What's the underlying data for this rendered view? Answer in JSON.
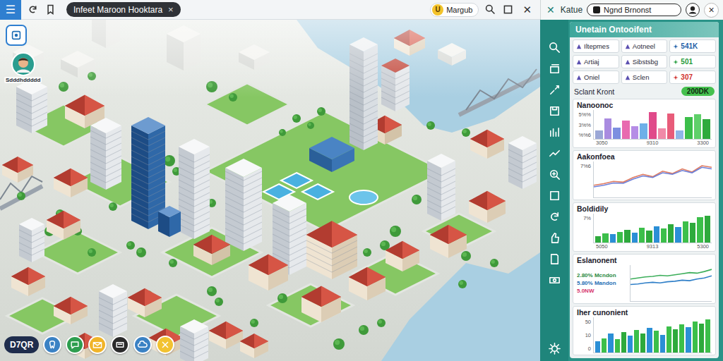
{
  "window": {
    "title": "Infeet Maroon Hooktara",
    "tab_close": "×",
    "menu": "☰",
    "close": "✕"
  },
  "currency": {
    "symbol": "U",
    "label": "Margub"
  },
  "player": {
    "name": "Sdddhddddd"
  },
  "toolbar": {
    "label": "D7QR"
  },
  "panel": {
    "close_left": "✕",
    "title": "Katue",
    "search": "Ngnd Brnonst",
    "close": "×",
    "heading": "Unetain Ontooifent",
    "stats": [
      {
        "label": "Iltepmes",
        "kind": "label"
      },
      {
        "label": "Aotneel",
        "kind": "label"
      },
      {
        "label": "541K",
        "kind": "value",
        "color": "#1f5fa8"
      },
      {
        "label": "Artiaj",
        "kind": "label"
      },
      {
        "label": "Sibstsbg",
        "kind": "label"
      },
      {
        "label": "501",
        "kind": "value",
        "color": "#1f9a3a"
      },
      {
        "label": "Oniel",
        "kind": "label"
      },
      {
        "label": "Sclen",
        "kind": "label"
      },
      {
        "label": "307",
        "kind": "value",
        "color": "#d0312d"
      }
    ],
    "summary": {
      "label": "Sclant Kront",
      "value": "200DK"
    },
    "charts": [
      {
        "title": "Nanoonoc",
        "kind": "bar",
        "ticks": [
          "5%%",
          "3%%",
          "%%6"
        ],
        "xlabels": [
          "3050",
          "9310",
          "3300"
        ],
        "values": [
          28,
          70,
          38,
          62,
          44,
          52,
          90,
          36,
          86,
          30,
          74,
          82,
          66
        ],
        "colors": [
          "#9aa7d6",
          "#a98be0",
          "#7d8fe0",
          "#e86ab0",
          "#b58ce6",
          "#6fb0e8",
          "#e04a8a",
          "#f08aa8",
          "#e85c7a",
          "#8fb6e8",
          "#3cbf4a",
          "#5fd06a",
          "#2eaa3c"
        ]
      },
      {
        "title": "Aakonfoea",
        "kind": "line",
        "ticks": [
          "7%6"
        ],
        "series": [
          {
            "values": [
              30,
              34,
              40,
              38,
              50,
              58,
              52,
              66,
              60,
              72,
              64,
              80,
              76
            ],
            "color": "#e07a5f"
          },
          {
            "values": [
              26,
              30,
              36,
              35,
              46,
              54,
              50,
              62,
              58,
              68,
              62,
              76,
              72
            ],
            "color": "#6c7fd8"
          }
        ]
      },
      {
        "title": "Boldidily",
        "kind": "bar",
        "ticks": [
          "7%"
        ],
        "xlabels": [
          "5050",
          "9313",
          "5300"
        ],
        "values": [
          20,
          30,
          26,
          34,
          40,
          32,
          46,
          38,
          50,
          44,
          58,
          48,
          66,
          62,
          80,
          84
        ],
        "colors": [
          "#2eaa3c",
          "#3cbf4a",
          "#2b8fd6",
          "#3cbf4a",
          "#2eaa3c",
          "#2b8fd6",
          "#3cbf4a",
          "#2eaa3c",
          "#2b8fd6",
          "#3cbf4a",
          "#2eaa3c",
          "#2b8fd6",
          "#3cbf4a",
          "#2eaa3c",
          "#3cbf4a",
          "#2eaa3c"
        ]
      },
      {
        "title": "Eslanonent",
        "kind": "line",
        "legend": [
          {
            "text": "2.80% Mcndon",
            "color": "#2b8a3e"
          },
          {
            "text": "5.80% Mandon",
            "color": "#1f6fb5"
          },
          {
            "text": "5.0NW",
            "color": "#d6336c"
          }
        ],
        "series": [
          {
            "values": [
              40,
              42,
              44,
              45,
              47,
              46,
              48,
              50,
              52,
              51,
              54,
              58
            ],
            "color": "#3cae5a"
          },
          {
            "values": [
              30,
              31,
              33,
              34,
              33,
              35,
              36,
              38,
              37,
              40,
              42,
              46
            ],
            "color": "#2f7fc8"
          }
        ]
      },
      {
        "title": "Iher cunonient",
        "kind": "bar",
        "ticks": [
          "50",
          "10",
          "0"
        ],
        "values": [
          24,
          30,
          40,
          28,
          44,
          36,
          48,
          40,
          52,
          46,
          38,
          56,
          50,
          60,
          54,
          66,
          62,
          70
        ],
        "colors": [
          "#2b8fd6",
          "#3cbf4a",
          "#2b8fd6",
          "#3cbf4a",
          "#2eaa3c",
          "#2b8fd6",
          "#3cbf4a",
          "#2eaa3c",
          "#2b8fd6",
          "#3cbf4a",
          "#2b8fd6",
          "#3cbf4a",
          "#2eaa3c",
          "#3cbf4a",
          "#2b8fd6",
          "#3cbf4a",
          "#2eaa3c",
          "#3cbf4a"
        ]
      }
    ]
  }
}
